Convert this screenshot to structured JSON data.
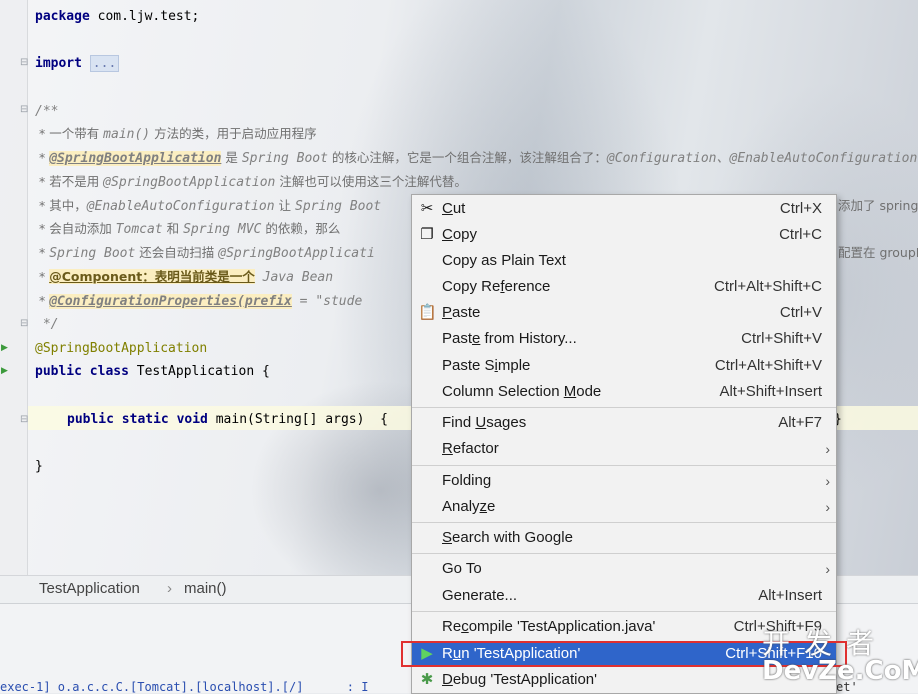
{
  "code": {
    "l1_kw": "package",
    "l1_rest": " com.ljw.test;",
    "l2_kw": "import",
    "l2_fold": "...",
    "l3": "/**",
    "l4_a": " * 一个带有 ",
    "l4_b": "main()",
    "l4_c": " 方法的类，用于启动应用程序",
    "l5_a": " * ",
    "l5_b": "@SpringBootApplication",
    "l5_c": " 是 ",
    "l5_d": "Spring Boot",
    "l5_e": " 的核心注解，它是一个组合注解，该注解组合了：",
    "l5_f": "@Configuration、@EnableAutoConfiguration",
    "l6_a": " * 若不是用 ",
    "l6_b": "@SpringBootApplication",
    "l6_c": " 注解也可以使用这三个注解代替。",
    "l7_a": " * 其中，",
    "l7_b": "@EnableAutoConfiguration",
    "l7_c": " 让 ",
    "l7_d": "Spring Boot",
    "l7_e": "添加了 spring-",
    "l8_a": " * 会自动添加 ",
    "l8_b": "Tomcat",
    "l8_c": " 和 ",
    "l8_d": "Spring MVC",
    "l8_e": " 的依赖，那么",
    "l9_a": " * ",
    "l9_b": "Spring Boot",
    "l9_c": " 还会自动扫描 ",
    "l9_d": "@SpringBootApplicati",
    "l9_e": "配置在 groupI",
    "l10_a": " * ",
    "l10_b": "@Component",
    "l10_c": "：表明当前类是一个",
    "l10_d": " Java Bean",
    "l11_a": " * ",
    "l11_b": "@ConfigurationProperties(prefix",
    "l11_c": " = \"stude",
    "l12": " */",
    "l13": "@SpringBootApplication",
    "l14_kw": "public class",
    "l14_rest": " TestApplication {",
    "l15_kw": "public static void",
    "l15_rest": " main(String[] args)  {",
    "l15_close": "}",
    "l16": "}"
  },
  "breadcrumb": {
    "cls": "TestApplication",
    "sep": "›",
    "method": "main()"
  },
  "bottom_text": "exec-1] o.a.c.c.C.[Tomcat].[localhost].[/]      : I",
  "bottom_right": "et'",
  "menu": {
    "items": [
      {
        "label": "Cut",
        "shortcut": "Ctrl+X",
        "icon": "scissors-icon"
      },
      {
        "label": "Copy",
        "shortcut": "Ctrl+C",
        "icon": "copy-icon"
      },
      {
        "label": "Copy as Plain Text",
        "shortcut": ""
      },
      {
        "label": "Copy Reference",
        "shortcut": "Ctrl+Alt+Shift+C"
      },
      {
        "label": "Paste",
        "shortcut": "Ctrl+V",
        "icon": "clipboard-icon"
      },
      {
        "label": "Paste from History...",
        "shortcut": "Ctrl+Shift+V"
      },
      {
        "label": "Paste Simple",
        "shortcut": "Ctrl+Alt+Shift+V"
      },
      {
        "label": "Column Selection Mode",
        "shortcut": "Alt+Shift+Insert"
      },
      {
        "label": "Find Usages",
        "shortcut": "Alt+F7"
      },
      {
        "label": "Refactor",
        "shortcut": ""
      },
      {
        "label": "Folding",
        "shortcut": ""
      },
      {
        "label": "Analyze",
        "shortcut": ""
      },
      {
        "label": "Search with Google",
        "shortcut": ""
      },
      {
        "label": "Go To",
        "shortcut": ""
      },
      {
        "label": "Generate...",
        "shortcut": "Alt+Insert"
      },
      {
        "label": "Recompile 'TestApplication.java'",
        "shortcut": "Ctrl+Shift+F9"
      },
      {
        "label": "Run 'TestApplication'",
        "shortcut": "Ctrl+Shift+F10",
        "icon": "run-icon"
      },
      {
        "label": "Debug 'TestApplication'",
        "shortcut": "",
        "icon": "debug-icon"
      }
    ]
  },
  "watermark": {
    "line1": "开发者",
    "line2": "DevZe.CoM"
  },
  "colors": {
    "selection": "#2f65ca",
    "highlight_border": "#e03030",
    "keyword": "#000080",
    "annotation": "#808000"
  }
}
